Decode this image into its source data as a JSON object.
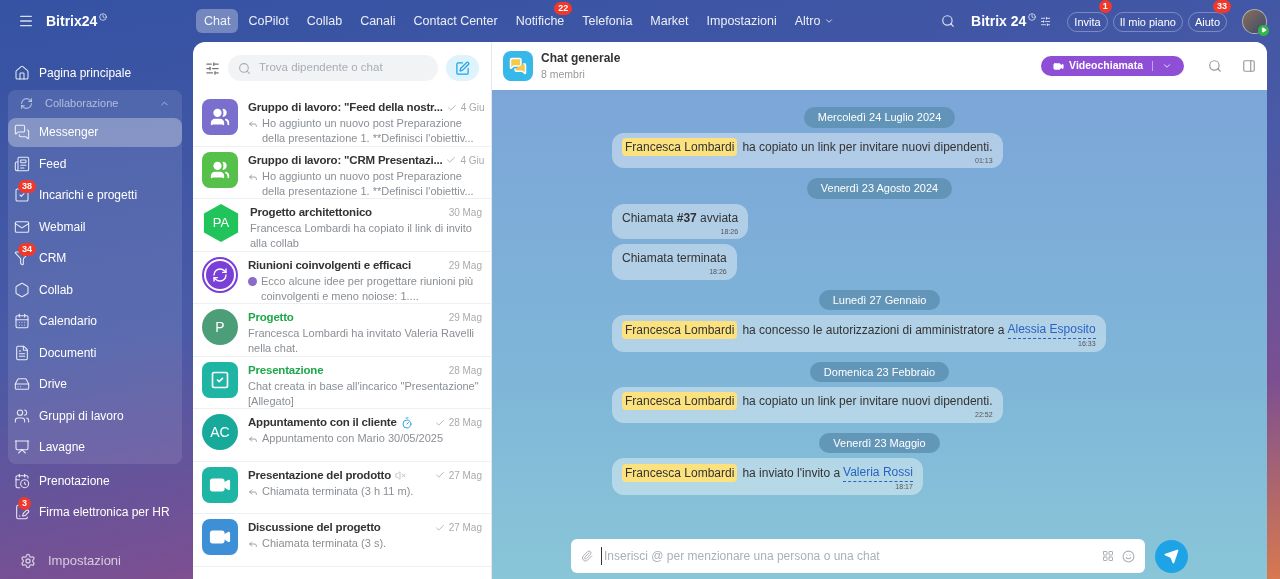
{
  "brand": {
    "name": "Bitrix24"
  },
  "top_nav": [
    {
      "label": "Chat",
      "selected": true
    },
    {
      "label": "CoPilot",
      "selected": false
    },
    {
      "label": "Collab",
      "selected": false
    },
    {
      "label": "Canali",
      "selected": false
    },
    {
      "label": "Contact Center",
      "selected": false
    },
    {
      "label": "Notifiche",
      "selected": false,
      "badge": "22"
    },
    {
      "label": "Telefonia",
      "selected": false
    },
    {
      "label": "Market",
      "selected": false
    },
    {
      "label": "Impostazioni",
      "selected": false
    },
    {
      "label": "Altro",
      "selected": false,
      "dropdown": true
    }
  ],
  "header_right": {
    "logo": "Bitrix",
    "logo_number": "24",
    "buttons": [
      {
        "label": "Invita",
        "badge": "1"
      },
      {
        "label": "Il mio piano"
      },
      {
        "label": "Aiuto",
        "badge": "33"
      }
    ]
  },
  "sidebar": {
    "items": [
      {
        "label": "Pagina principale",
        "selected": false
      },
      {
        "label": "Collaborazione",
        "expanded": true,
        "children": [
          {
            "label": "Messenger",
            "selected": true
          },
          {
            "label": "Feed",
            "selected": false
          },
          {
            "label": "Incarichi e progetti",
            "selected": false,
            "badge": "38"
          },
          {
            "label": "Webmail",
            "selected": false
          },
          {
            "label": "CRM",
            "selected": false,
            "badge": "34"
          },
          {
            "label": "Collab",
            "selected": false
          },
          {
            "label": "Calendario",
            "selected": false
          },
          {
            "label": "Documenti",
            "selected": false
          },
          {
            "label": "Drive",
            "selected": false
          },
          {
            "label": "Gruppi di lavoro",
            "selected": false
          },
          {
            "label": "Lavagne",
            "selected": false
          }
        ]
      },
      {
        "label": "Prenotazione",
        "selected": false
      },
      {
        "label": "Firma elettronica per HR",
        "selected": false,
        "badge": "3"
      }
    ],
    "footer": {
      "label": "Impostazioni"
    }
  },
  "chat_list": {
    "search_placeholder": "Trova dipendente o chat",
    "items": [
      {
        "title": "Gruppo di lavoro: \"Feed della nostr...",
        "date": "4 Giu",
        "read": true,
        "reply": true,
        "timer": false,
        "muted": false,
        "bot": false,
        "preview": "Ho aggiunto un nuovo post Preparazione della presentazione 1. **Definisci l'obiettiv...",
        "avatar": {
          "kind": "group",
          "color": "#7b6fce"
        },
        "external": false
      },
      {
        "title": "Gruppo di lavoro: \"CRM Presentazi...",
        "date": "4 Giu",
        "read": true,
        "reply": true,
        "timer": false,
        "muted": false,
        "bot": false,
        "preview": "Ho aggiunto un nuovo post Preparazione della presentazione 1. **Definisci l'obiettiv...",
        "avatar": {
          "kind": "group",
          "color": "#55c14a"
        },
        "external": false
      },
      {
        "title": "Progetto architettonico",
        "date": "30 Mag",
        "read": false,
        "reply": false,
        "timer": false,
        "muted": false,
        "bot": false,
        "preview": "Francesca Lombardi ha copiato il link di invito alla collab",
        "avatar": {
          "kind": "hexagon",
          "color": "#21c45a",
          "initials": "PA"
        },
        "external": false
      },
      {
        "title": "Riunioni coinvolgenti e efficaci",
        "date": "29 Mag",
        "read": false,
        "reply": false,
        "timer": false,
        "muted": false,
        "bot": true,
        "preview": "Ecco alcune idee per progettare riunioni più coinvolgenti e meno noiose: 1....",
        "avatar": {
          "kind": "copilot",
          "color": "#7a3fd6"
        },
        "external": false
      },
      {
        "title": "Progetto",
        "date": "29 Mag",
        "read": false,
        "reply": false,
        "timer": false,
        "muted": false,
        "bot": false,
        "preview": "Francesca Lombardi ha invitato Valeria Ravelli nella chat.",
        "avatar": {
          "kind": "initials",
          "color": "#4c9e78",
          "initials": "P"
        },
        "external": true
      },
      {
        "title": "Presentazione",
        "date": "28 Mag",
        "read": false,
        "reply": false,
        "timer": false,
        "muted": false,
        "bot": false,
        "preview": "Chat creata in base all'incarico \"Presentazione\" [Allegato]",
        "avatar": {
          "kind": "task",
          "color": "#1fb5a4"
        },
        "external": true
      },
      {
        "title": "Appuntamento con il cliente",
        "date": "28 Mag",
        "read": true,
        "reply": true,
        "timer": true,
        "muted": false,
        "bot": false,
        "preview": "Appuntamento con Mario 30/05/2025",
        "avatar": {
          "kind": "initials",
          "color": "#17a99a",
          "initials": "AC"
        },
        "external": false
      },
      {
        "title": "Presentazione del prodotto",
        "date": "27 Mag",
        "read": true,
        "reply": true,
        "timer": false,
        "muted": true,
        "bot": false,
        "preview": "Chiamata terminata (3 h 11 m).",
        "avatar": {
          "kind": "video",
          "color": "#1fb5a4"
        },
        "external": false
      },
      {
        "title": "Discussione del progetto",
        "date": "27 Mag",
        "read": true,
        "reply": true,
        "timer": false,
        "muted": false,
        "bot": false,
        "preview": "Chiamata terminata (3 s).",
        "avatar": {
          "kind": "video",
          "color": "#3d8fd6"
        },
        "external": false
      }
    ]
  },
  "chat": {
    "title": "Chat generale",
    "subtitle": "8 membri",
    "call_button": "Videochiamata",
    "messages": [
      {
        "kind": "date",
        "text": "Mercoledì 24 Luglio 2024"
      },
      {
        "kind": "system",
        "author": "Francesca Lombardi",
        "text": "ha copiato un link per invitare nuovi dipendenti.",
        "time": "01:13"
      },
      {
        "kind": "date",
        "text": "Venerdì 23 Agosto 2024"
      },
      {
        "kind": "plain",
        "text": "Chiamata **#37** avviata",
        "time": "18:26"
      },
      {
        "kind": "plain",
        "text": "Chiamata terminata",
        "time": "18:26"
      },
      {
        "kind": "date",
        "text": "Lunedì 27 Gennaio"
      },
      {
        "kind": "system",
        "author": "Francesca Lombardi",
        "text": "ha concesso le autorizzazioni di amministratore a",
        "link": "Alessia Esposito",
        "time": "16:33"
      },
      {
        "kind": "date",
        "text": "Domenica 23 Febbraio"
      },
      {
        "kind": "system",
        "author": "Francesca Lombardi",
        "text": "ha copiato un link per invitare nuovi dipendenti.",
        "time": "22:52"
      },
      {
        "kind": "date",
        "text": "Venerdì 23 Maggio"
      },
      {
        "kind": "system",
        "author": "Francesca Lombardi",
        "text": "ha inviato l'invito a",
        "link": "Valeria Rossi",
        "time": "18:17"
      }
    ],
    "input_placeholder": "Inserisci @ per menzionare una persona o una chat"
  }
}
